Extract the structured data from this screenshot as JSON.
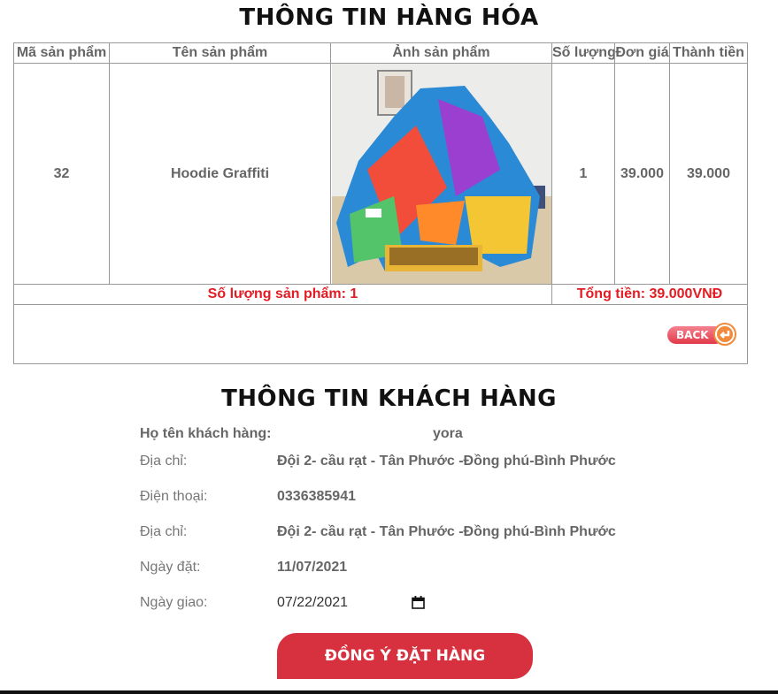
{
  "product_section": {
    "title": "THÔNG TIN HÀNG HÓA",
    "headers": [
      "Mã sản phẩm",
      "Tên sản phẩm",
      "Ảnh sản phẩm",
      "Số lượng",
      "Đơn giá",
      "Thành tiền"
    ],
    "rows": [
      {
        "id": "32",
        "name": "Hoodie Graffiti",
        "image": "product-photo",
        "quantity": "1",
        "unit_price": "39.000",
        "total": "39.000"
      }
    ],
    "summary": {
      "count": "Số lượng sản phẩm: 1",
      "total": "Tổng tiền: 39.000VNĐ"
    },
    "back_label": "BACK"
  },
  "customer_section": {
    "title": "THÔNG TIN KHÁCH HÀNG",
    "name_label": "Họ tên khách hàng:",
    "name_value": "yora",
    "address_label": "Địa chỉ:",
    "address_value": "Đội 2- cầu rạt - Tân Phước -Đồng phú-Bình Phước",
    "phone_label": "Điện thoại:",
    "phone_value": "0336385941",
    "address2_label": "Địa chỉ:",
    "address2_value": "Đội 2- cầu rạt - Tân Phước -Đồng phú-Bình Phước",
    "order_date_label": "Ngày đặt:",
    "order_date_value": "11/07/2021",
    "delivery_date_label": "Ngày giao:",
    "delivery_date_value": "07/22/2021"
  },
  "submit_label": "ĐỒNG Ý ĐẶT HÀNG",
  "colors": {
    "accent_red": "#d7313f",
    "summary_red": "#e31b23"
  }
}
